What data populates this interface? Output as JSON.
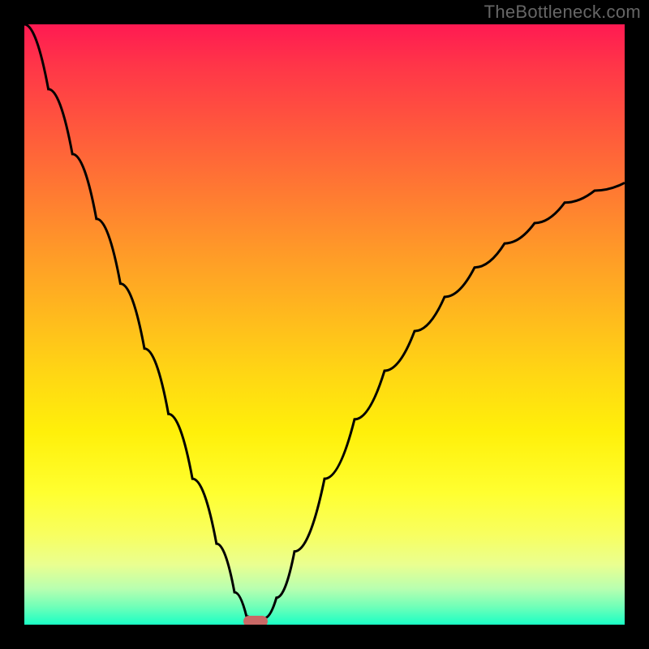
{
  "attribution": "TheBottleneck.com",
  "chart_data": {
    "type": "line",
    "title": "",
    "xlabel": "",
    "ylabel": "",
    "xlim": [
      0,
      100
    ],
    "x": [
      0,
      4,
      8,
      12,
      16,
      20,
      24,
      28,
      32,
      35,
      37,
      38.5,
      40,
      42,
      45,
      50,
      55,
      60,
      65,
      70,
      75,
      80,
      85,
      90,
      95,
      100
    ],
    "values": [
      100,
      89.2,
      78.4,
      67.6,
      56.8,
      46,
      35.1,
      24.3,
      13.5,
      5.4,
      1.4,
      0,
      1.1,
      4.5,
      12.2,
      24.3,
      34.2,
      42.3,
      48.9,
      54.6,
      59.5,
      63.5,
      66.9,
      70.3,
      72.3,
      73.6
    ],
    "ylim": [
      0,
      100
    ],
    "marker": {
      "x": 38.5,
      "y": 0
    }
  },
  "colors": {
    "frame": "#000000",
    "curve": "#000000",
    "marker": "#c96866"
  }
}
